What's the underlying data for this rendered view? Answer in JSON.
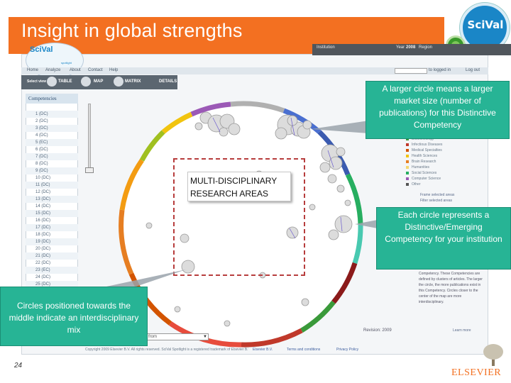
{
  "slide": {
    "title": "Insight in global strengths",
    "page_number": "24",
    "elsevier_brand": "ELSEVIER",
    "badge_label": "SciVal"
  },
  "app": {
    "logo": "SciVal",
    "logo_sub": "spotlight",
    "top_bar": {
      "institution_label": "Institution",
      "year_label": "Year",
      "year_value": "2008",
      "region_label": "Region"
    },
    "menu": [
      "Home",
      "Analyze",
      "About",
      "Contact",
      "Help"
    ],
    "login_label": "to logged in",
    "logout_label": "Log out",
    "select_view_label": "Select view",
    "views": [
      "TABLE",
      "MAP",
      "MATRIX",
      "DETAILS"
    ],
    "competencies_header": "Competencies",
    "competencies": [
      "1 (DC)",
      "2 (DC)",
      "3 (DC)",
      "4 (DC)",
      "5 (EC)",
      "6 (DC)",
      "7 (DC)",
      "8 (DC)",
      "9 (DC)",
      "10 (DC)",
      "11 (DC)",
      "12 (DC)",
      "13 (DC)",
      "14 (DC)",
      "15 (DC)",
      "16 (DC)",
      "17 (DC)",
      "18 (DC)",
      "19 (DC)",
      "20 (DC)",
      "21 (DC)",
      "22 (DC)",
      "23 (EC)",
      "24 (DC)",
      "25 (DC)"
    ],
    "legend": [
      {
        "label": "Biotechnology",
        "color": "#3a9a3a"
      },
      {
        "label": "Infectious Diseases",
        "color": "#c0392b"
      },
      {
        "label": "Medical Specialties",
        "color": "#d35400"
      },
      {
        "label": "Health Sciences",
        "color": "#f1c40f"
      },
      {
        "label": "Brain Research",
        "color": "#e67e22"
      },
      {
        "label": "Humanities",
        "color": "#f5d76e"
      },
      {
        "label": "Social Sciences",
        "color": "#27ae60"
      },
      {
        "label": "Computer Science",
        "color": "#9b59b6"
      },
      {
        "label": "Other",
        "color": "#555555"
      }
    ],
    "legend_links": [
      "Frame selected areas",
      "Filter selected areas"
    ],
    "info_text": "Competency. These Competencies are defined by clusters of articles. The larger the circle, the more publications exist in this Competency. Circles closer to the center of the map are more interdisciplinary.",
    "revision": "Revision: 2009",
    "learn_more": "Learn more",
    "view_select_value": "from",
    "footer_links": [
      "Elsevier B.V.",
      "Terms and conditions",
      "Privacy Policy"
    ],
    "footer_copyright": "Copyright 2009 Elsevier B.V. All rights reserved. SciVal Spotlight is a registered trademark of Elsevier B.V."
  },
  "annotations": {
    "multidisciplinary_line1": "MULTI-DISCIPLINARY",
    "multidisciplinary_line2": "RESEARCH AREAS",
    "callout_larger": "A larger circle means a larger market size (number of publications) for this Distinctive Competency",
    "callout_each": "Each circle represents a Distinctive/Emerging Competency for your institution",
    "callout_middle": "Circles positioned towards the middle indicate an interdisciplinary mix"
  }
}
